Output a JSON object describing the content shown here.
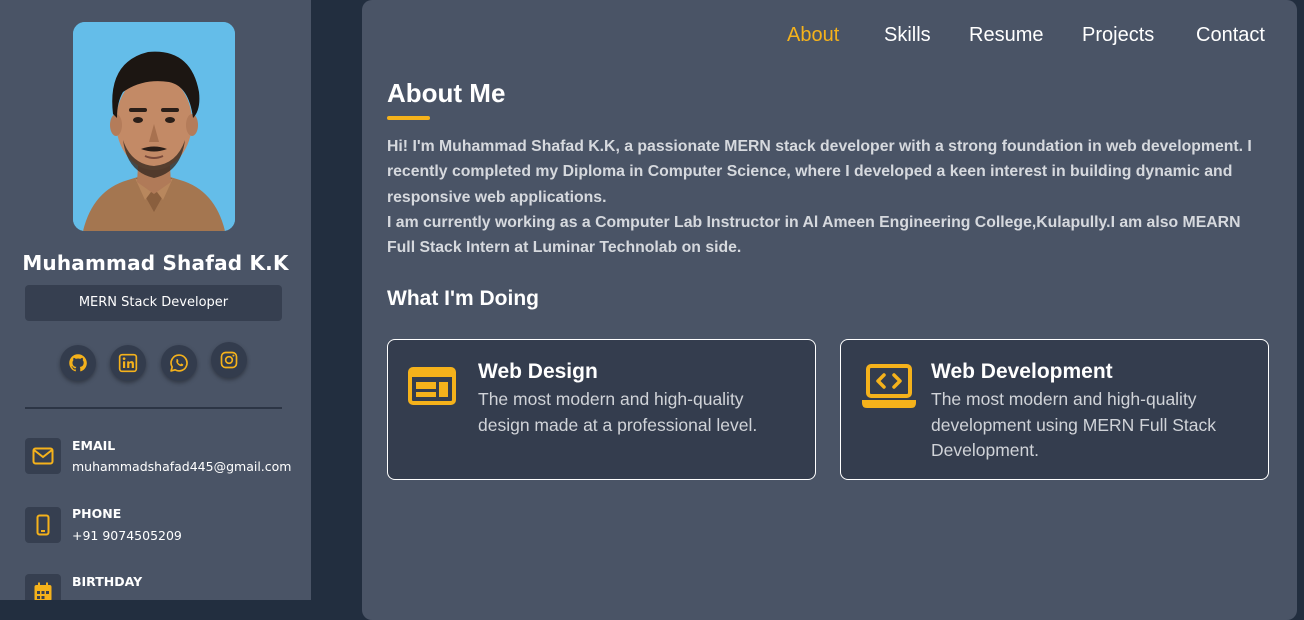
{
  "profile": {
    "name": "Muhammad Shafad K.K",
    "role": "MERN Stack Developer"
  },
  "social": [
    "github-icon",
    "linkedin-icon",
    "whatsapp-icon",
    "instagram-icon"
  ],
  "contacts": {
    "email": {
      "label": "EMAIL",
      "value": "muhammadshafad445@gmail.com"
    },
    "phone": {
      "label": "PHONE",
      "value": "+91 9074505209"
    },
    "birthday": {
      "label": "BIRTHDAY"
    }
  },
  "nav": {
    "about": "About",
    "skills": "Skills",
    "resume": "Resume",
    "projects": "Projects",
    "contact": "Contact",
    "active": "About"
  },
  "about": {
    "title": "About Me",
    "paragraph1": "Hi! I'm Muhammad Shafad K.K, a passionate MERN stack developer with a strong foundation in web development. I recently completed my Diploma in Computer Science, where I developed a keen interest in building dynamic and responsive web applications.",
    "paragraph2": "I am currently working as a Computer Lab Instructor in Al Ameen Engineering College,Kulapully.I am also MEARN Full Stack Intern at Luminar Technolab on side."
  },
  "doing": {
    "title": "What I'm Doing",
    "cards": [
      {
        "title": "Web Design",
        "text": "The most modern and high-quality design made at a professional level.",
        "icon": "web-design-icon"
      },
      {
        "title": "Web Development",
        "text": "The most modern and high-quality development using MERN Full Stack Development.",
        "icon": "laptop-code-icon"
      }
    ]
  },
  "colors": {
    "accent": "#f5b21b",
    "panel": "#4a5466",
    "background": "#222e3f",
    "card": "#343d4e"
  }
}
